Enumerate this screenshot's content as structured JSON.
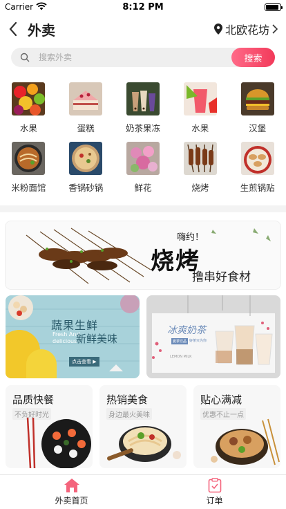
{
  "status": {
    "carrier": "Carrier",
    "time": "8:12 PM",
    "battery_level": 0.9
  },
  "nav": {
    "title": "外卖",
    "location": "北欧花坊"
  },
  "search": {
    "placeholder": "搜索外卖",
    "button": "搜索"
  },
  "categories": [
    {
      "label": "水果",
      "icon": "fruit"
    },
    {
      "label": "蛋糕",
      "icon": "cake"
    },
    {
      "label": "奶茶果冻",
      "icon": "milk-tea"
    },
    {
      "label": "水果",
      "icon": "fruit-juice"
    },
    {
      "label": "汉堡",
      "icon": "burger"
    },
    {
      "label": "米粉面馆",
      "icon": "noodles"
    },
    {
      "label": "香锅砂锅",
      "icon": "hot-pot"
    },
    {
      "label": "鲜花",
      "icon": "flowers"
    },
    {
      "label": "烧烤",
      "icon": "bbq"
    },
    {
      "label": "生煎锅贴",
      "icon": "dumplings"
    }
  ],
  "banners": {
    "bbq": {
      "tag": "嗨约！",
      "title": "烧烤",
      "sub": "撸串好食材"
    },
    "fresh": {
      "title1": "蔬果生鲜",
      "en1": "Fresh And",
      "en2": "delicious",
      "title2": "新鲜美味",
      "btn": "点击查看 ▶"
    },
    "tea": {
      "title": "冰爽奶茶",
      "tag": "夏季饮品",
      "sub": "好茶只为你",
      "en": "LEMON MILK"
    }
  },
  "cards": [
    {
      "title": "品质快餐",
      "sub": "不负好时光"
    },
    {
      "title": "热销美食",
      "sub": "身边最火美味"
    },
    {
      "title": "贴心满减",
      "sub": "优惠不止一点"
    }
  ],
  "tabs": [
    {
      "label": "外卖首页",
      "active": true
    },
    {
      "label": "订单",
      "active": false
    }
  ],
  "colors": {
    "accent": "#f23a5a",
    "tab_active": "#f4647c"
  }
}
